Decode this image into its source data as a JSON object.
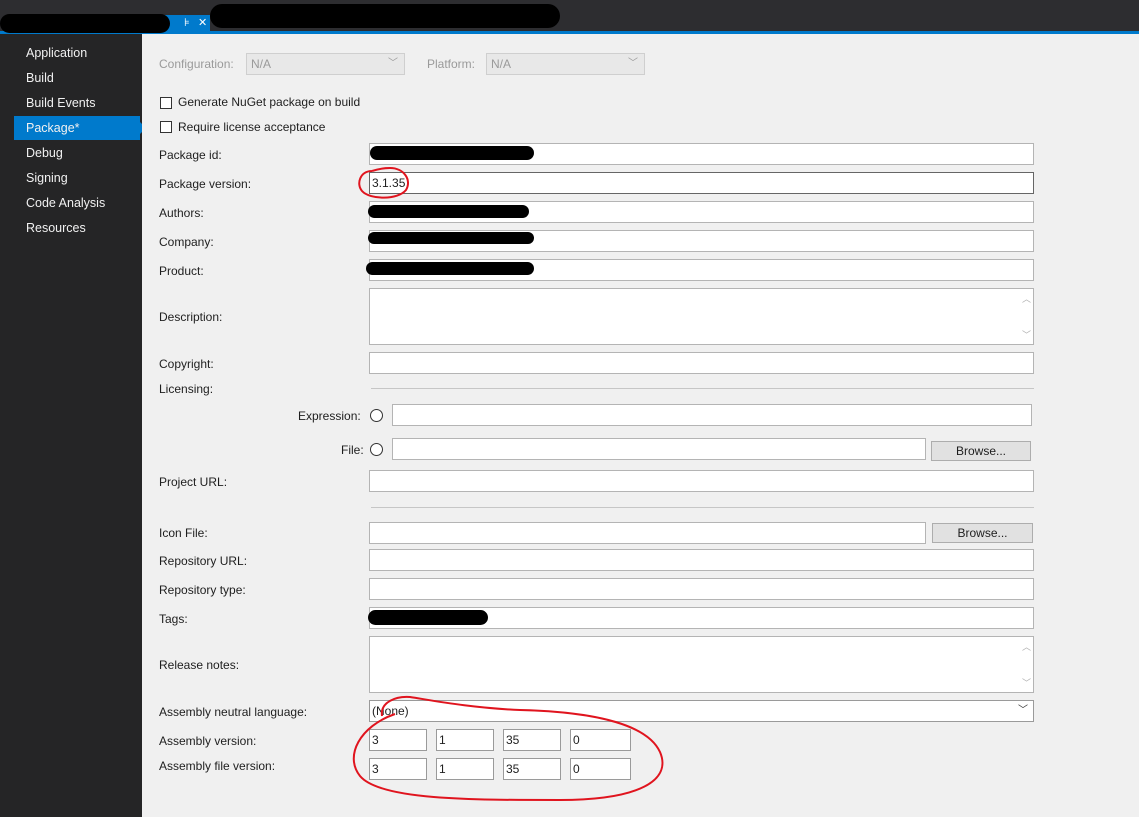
{
  "sidebar": {
    "items": [
      "Application",
      "Build",
      "Build Events",
      "Package*",
      "Debug",
      "Signing",
      "Code Analysis",
      "Resources"
    ],
    "active_index": 3
  },
  "header": {
    "configuration_label": "Configuration:",
    "configuration_value": "N/A",
    "platform_label": "Platform:",
    "platform_value": "N/A"
  },
  "checkboxes": {
    "generate_nuget": "Generate NuGet package on build",
    "require_license": "Require license acceptance"
  },
  "fields": {
    "package_id_label": "Package id:",
    "package_version_label": "Package version:",
    "package_version_value": "3.1.35",
    "authors_label": "Authors:",
    "company_label": "Company:",
    "product_label": "Product:",
    "description_label": "Description:",
    "copyright_label": "Copyright:",
    "licensing_label": "Licensing:",
    "expression_label": "Expression:",
    "file_label": "File:",
    "browse_label": "Browse...",
    "project_url_label": "Project URL:",
    "icon_file_label": "Icon File:",
    "repository_url_label": "Repository URL:",
    "repository_type_label": "Repository type:",
    "tags_label": "Tags:",
    "release_notes_label": "Release notes:",
    "neutral_language_label": "Assembly neutral language:",
    "neutral_language_value": "(None)",
    "assembly_version_label": "Assembly version:",
    "assembly_file_version_label": "Assembly file version:"
  },
  "assembly_version": [
    "3",
    "1",
    "35",
    "0"
  ],
  "assembly_file_version": [
    "3",
    "1",
    "35",
    "0"
  ],
  "icons": {
    "tab_pin": "pin-icon",
    "tab_close": "close-icon",
    "chevron": "chevron-down-icon",
    "scroll_up": "scroll-up-icon",
    "scroll_down": "scroll-down-icon"
  },
  "colors": {
    "accent": "#007acc",
    "sidebar_bg": "#252526",
    "titlebar_bg": "#2d2d30",
    "panel_bg": "#f0f0f0",
    "annotation": "#e0141e"
  }
}
